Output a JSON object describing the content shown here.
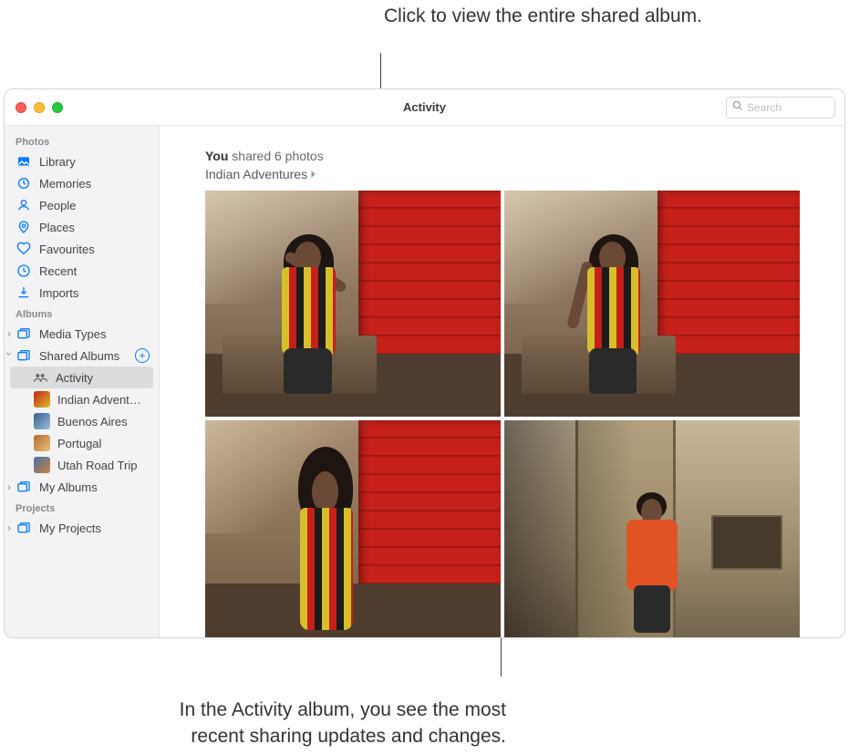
{
  "callouts": {
    "top": "Click to view the entire shared album.",
    "bottom": "In the Activity album, you see the most recent sharing updates and changes."
  },
  "window": {
    "title": "Activity",
    "search_placeholder": "Search"
  },
  "sidebar": {
    "sections": {
      "photos_header": "Photos",
      "albums_header": "Albums",
      "projects_header": "Projects"
    },
    "photos": {
      "library": "Library",
      "memories": "Memories",
      "people": "People",
      "places": "Places",
      "favourites": "Favourites",
      "recent": "Recent",
      "imports": "Imports"
    },
    "albums": {
      "media_types": "Media Types",
      "shared_albums": "Shared Albums",
      "activity": "Activity",
      "indian_adventures": "Indian Advent…",
      "buenos_aires": "Buenos Aires",
      "portugal": "Portugal",
      "utah_road_trip": "Utah Road Trip",
      "my_albums": "My Albums"
    },
    "projects": {
      "my_projects": "My Projects"
    }
  },
  "activity": {
    "actor": "You",
    "action_text": " shared 6 photos",
    "album_name": "Indian Adventures"
  },
  "colors": {
    "accent": "#0a7bff",
    "sidebar_bg": "#f3f3f5",
    "selection": "#dcdcdc"
  }
}
